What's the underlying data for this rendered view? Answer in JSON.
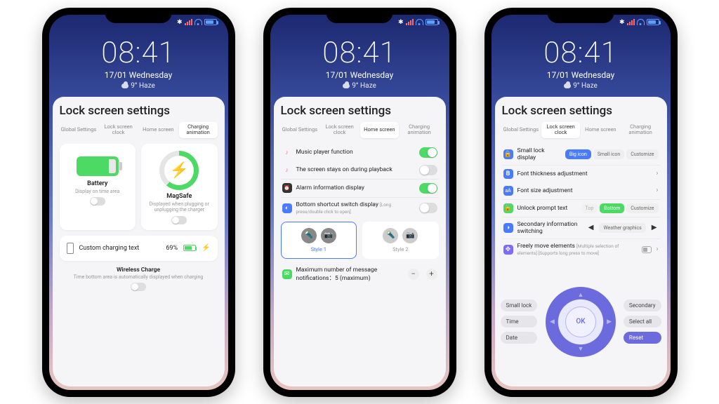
{
  "status": {
    "bt": "✱"
  },
  "lock": {
    "time": "08:41",
    "date": "17/01 Wednesday",
    "weather": "9° Haze"
  },
  "panel_title": "Lock screen settings",
  "tabs": [
    "Global Settings",
    "Lock screen clock",
    "Home screen",
    "Charging animation"
  ],
  "phone1": {
    "battery": {
      "title": "Battery",
      "sub": "Display on time area"
    },
    "magsafe": {
      "title": "MagSafe",
      "sub": "Displayed when plugging or unplugging the charger"
    },
    "custom": {
      "label": "Custom charging text",
      "pct": "69%",
      "bolt": "⚡"
    },
    "wireless": {
      "title": "Wireless Charge",
      "sub": "Time bottom area is automatically displayed when charging"
    }
  },
  "phone2": {
    "music1": "Music player function",
    "music2": "The screen stays on during playback",
    "alarm": "Alarm information display",
    "bottom": {
      "label": "Bottom shortcut switch display",
      "hint": "[Long press/double click to open]"
    },
    "style1": "Style 1",
    "style2": "Style 2",
    "max": {
      "label": "Maximum number of message notifications：5 (maximum)"
    }
  },
  "phone3": {
    "small": {
      "label": "Small lock display",
      "opts": [
        "Big icon",
        "Small icon",
        "Customize"
      ]
    },
    "thick": "Font thickness adjustment",
    "size": "Font size adjustment",
    "unlock": {
      "label": "Unlock prompt text",
      "opts": [
        "Top",
        "Bottom",
        "Customize"
      ]
    },
    "sec": {
      "label": "Secondary information switching",
      "val": "Weather graphics"
    },
    "move": {
      "label": "Freely move elements",
      "hint": "[Multiple selection of elements] [Supports long press to move]"
    },
    "left": [
      "Small lock",
      "Time",
      "Date"
    ],
    "right": [
      "Secondary",
      "Select all",
      "Reset"
    ],
    "ok": "OK"
  }
}
